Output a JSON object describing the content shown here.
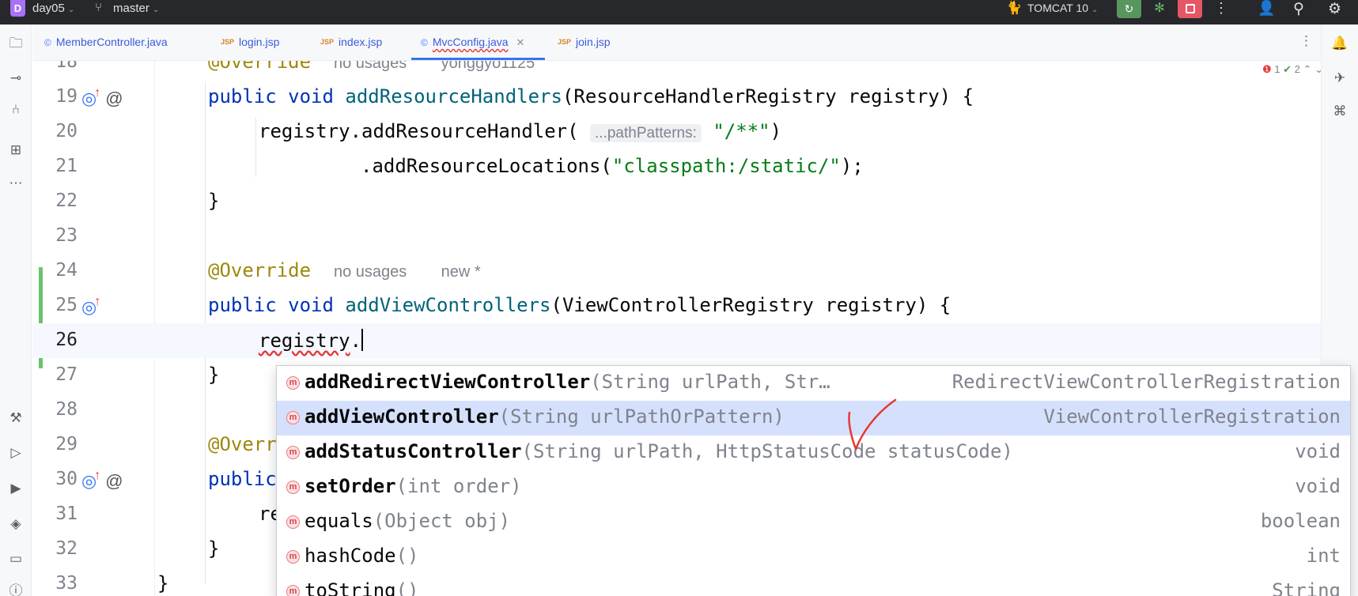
{
  "titlebar": {
    "project_badge": "D",
    "project_name": "day05",
    "branch": "master",
    "run_config": "TOMCAT 10"
  },
  "tabs": [
    {
      "label": "MemberController.java",
      "type": "java"
    },
    {
      "label": "login.jsp",
      "type": "jsp"
    },
    {
      "label": "index.jsp",
      "type": "jsp"
    },
    {
      "label": "MvcConfig.java",
      "type": "java",
      "active": true
    },
    {
      "label": "join.jsp",
      "type": "jsp"
    }
  ],
  "tab_icons": {
    "java": "©",
    "jsp": "JSP"
  },
  "inspections": {
    "errors": "1",
    "warnings": "2"
  },
  "editor": {
    "lines": [
      {
        "num": "18",
        "annotation": "@Override",
        "hint1": "no usages",
        "hint2": "yonggyo1125"
      },
      {
        "num": "19",
        "kw1": "public",
        "kw2": "void",
        "fn": "addResourceHandlers",
        "rest": "(ResourceHandlerRegistry registry) {"
      },
      {
        "num": "20",
        "pre": "registry.addResourceHandler(",
        "param_hint": "...pathPatterns:",
        "str": "\"/**\"",
        "post": ")"
      },
      {
        "num": "21",
        "pre": ".addResourceLocations(",
        "str": "\"classpath:/static/\"",
        "post": ");"
      },
      {
        "num": "22",
        "text": "}"
      },
      {
        "num": "23",
        "text": ""
      },
      {
        "num": "24",
        "annotation": "@Override",
        "hint1": "no usages",
        "hint2": "new *"
      },
      {
        "num": "25",
        "kw1": "public",
        "kw2": "void",
        "fn": "addViewControllers",
        "rest": "(ViewControllerRegistry registry) {"
      },
      {
        "num": "26",
        "text_squiggle": "registry",
        "text_after": "."
      },
      {
        "num": "27",
        "text": "}"
      },
      {
        "num": "28",
        "text": ""
      },
      {
        "num": "29",
        "annotation": "@Overri"
      },
      {
        "num": "30",
        "kw1": "public"
      },
      {
        "num": "31",
        "text": "re"
      },
      {
        "num": "32",
        "text": "}"
      },
      {
        "num": "33",
        "text": "}"
      }
    ]
  },
  "completion": {
    "items": [
      {
        "name": "addRedirectViewController",
        "sig": "(String urlPath, Str…",
        "ret": "RedirectViewControllerRegistration",
        "bold": true
      },
      {
        "name": "addViewController",
        "sig": "(String urlPathOrPattern)",
        "ret": "ViewControllerRegistration",
        "bold": true,
        "selected": true
      },
      {
        "name": "addStatusController",
        "sig": "(String urlPath, HttpStatusCode statusCode)",
        "ret": "void",
        "bold": true
      },
      {
        "name": "setOrder",
        "sig": "(int order)",
        "ret": "void",
        "bold": true
      },
      {
        "name": "equals",
        "sig": "(Object obj)",
        "ret": "boolean",
        "bold": false
      },
      {
        "name": "hashCode",
        "sig": "()",
        "ret": "int",
        "bold": false
      },
      {
        "name": "toString",
        "sig": "()",
        "ret": "String",
        "bold": false
      }
    ],
    "method_icon": "m"
  },
  "colors": {
    "keyword": "#0033b3",
    "function": "#00627a",
    "annotation": "#9e880d",
    "string": "#067d17",
    "selection": "#d5e1fc",
    "accent": "#3574f0",
    "checkmark": "#e53935"
  },
  "icons": {
    "left": [
      "folder-icon",
      "commit-icon",
      "pull-requests-icon",
      "structure-icon",
      "more-tools-icon",
      "build-icon",
      "services-icon",
      "run-icon",
      "layers-icon",
      "terminal-icon",
      "problems-icon"
    ],
    "right": [
      "notifications-icon",
      "copilot-icon",
      "python-icon"
    ]
  }
}
